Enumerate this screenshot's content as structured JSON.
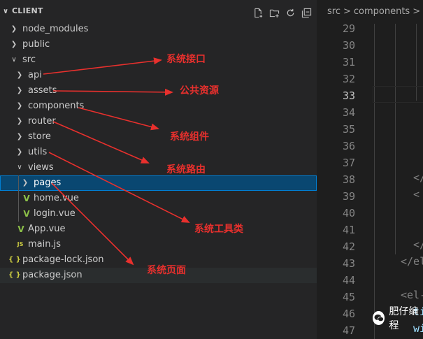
{
  "explorer": {
    "title": "CLIENT",
    "actions": [
      "new-file-icon",
      "new-folder-icon",
      "refresh-icon",
      "collapse-all-icon"
    ],
    "items": [
      {
        "label": "node_modules",
        "type": "folder",
        "expanded": false
      },
      {
        "label": "public",
        "type": "folder",
        "expanded": false
      },
      {
        "label": "src",
        "type": "folder",
        "expanded": true
      },
      {
        "label": "api",
        "type": "folder",
        "expanded": false
      },
      {
        "label": "assets",
        "type": "folder",
        "expanded": false
      },
      {
        "label": "components",
        "type": "folder",
        "expanded": false
      },
      {
        "label": "router",
        "type": "folder",
        "expanded": false
      },
      {
        "label": "store",
        "type": "folder",
        "expanded": false
      },
      {
        "label": "utils",
        "type": "folder",
        "expanded": false
      },
      {
        "label": "views",
        "type": "folder",
        "expanded": true
      },
      {
        "label": "pages",
        "type": "folder",
        "expanded": false,
        "selected": true
      },
      {
        "label": "home.vue",
        "type": "vue"
      },
      {
        "label": "login.vue",
        "type": "vue"
      },
      {
        "label": "App.vue",
        "type": "vue"
      },
      {
        "label": "main.js",
        "type": "js",
        "icon_text": "JS"
      },
      {
        "label": "package-lock.json",
        "type": "json",
        "icon_text": "{ }"
      },
      {
        "label": "package.json",
        "type": "json",
        "icon_text": "{ }",
        "hovered": true
      }
    ]
  },
  "annotations": {
    "api": "系统接口",
    "assets": "公共资源",
    "components": "系统组件",
    "router": "系统路由",
    "utils": "系统工具类",
    "views": "系统页面"
  },
  "editor": {
    "breadcrumb": [
      "src",
      "components"
    ],
    "breadcrumb_sep": ">",
    "breadcrumb_file_icon": "V",
    "line_numbers": [
      "29",
      "30",
      "31",
      "32",
      "33",
      "34",
      "35",
      "36",
      "37",
      "38",
      "39",
      "40",
      "41",
      "42",
      "43",
      "44",
      "45",
      "46",
      "47"
    ],
    "active_line": "33",
    "code_fragments": {
      "line38": "</",
      "line39": "<",
      "line42": "</",
      "line43": "</el",
      "line45": "<el-",
      "line46": "ti",
      "line47": "wi"
    }
  },
  "watermark": {
    "text": "肥仔编程"
  },
  "colors": {
    "annotation": "#e8302d",
    "selection": "#094771",
    "vue": "#8dc149",
    "json_js": "#cbcb41",
    "tag": "#808080",
    "attr": "#9cdcfe"
  }
}
